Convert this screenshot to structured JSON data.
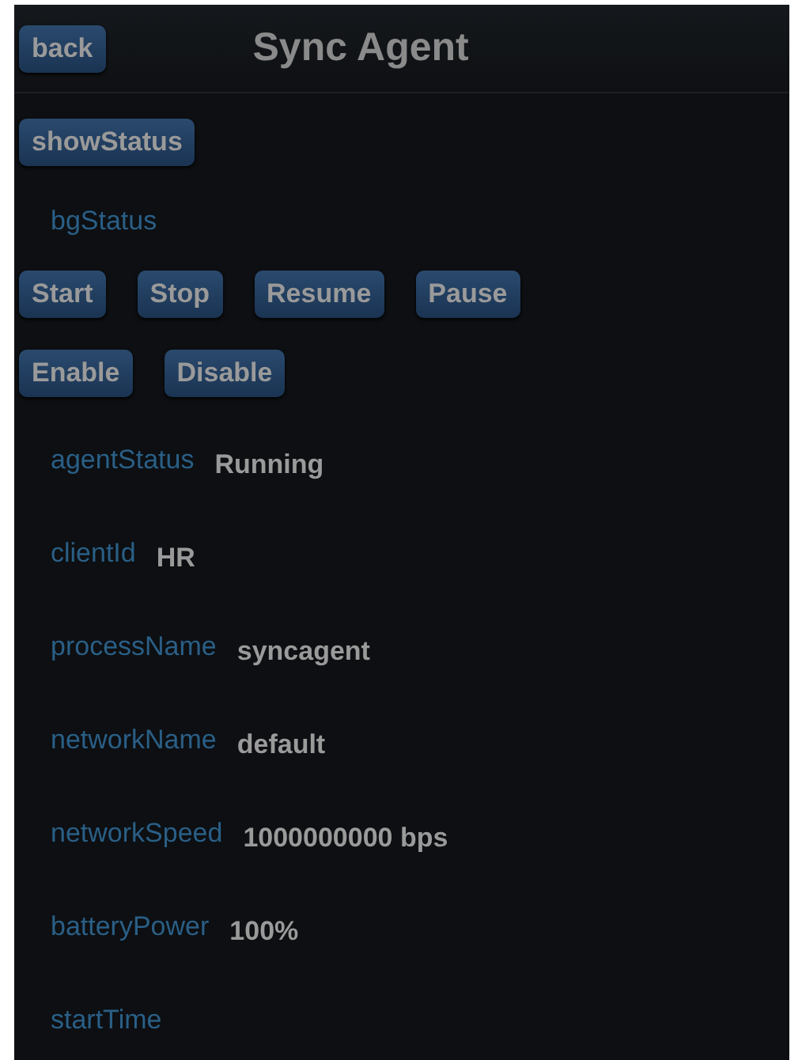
{
  "header": {
    "back_button": "back",
    "title": "Sync Agent"
  },
  "show_status_button": "showStatus",
  "bg_status_label": "bgStatus",
  "control_buttons": [
    [
      "Start",
      "Stop",
      "Resume",
      "Pause"
    ],
    [
      "Enable",
      "Disable"
    ]
  ],
  "fields": [
    {
      "label": "agentStatus",
      "value": "Running"
    },
    {
      "label": "clientId",
      "value": "HR"
    },
    {
      "label": "processName",
      "value": "syncagent"
    },
    {
      "label": "networkName",
      "value": "default"
    },
    {
      "label": "networkSpeed",
      "value": "1000000000 bps"
    },
    {
      "label": "batteryPower",
      "value": "100%"
    },
    {
      "label": "startTime"
    }
  ]
}
